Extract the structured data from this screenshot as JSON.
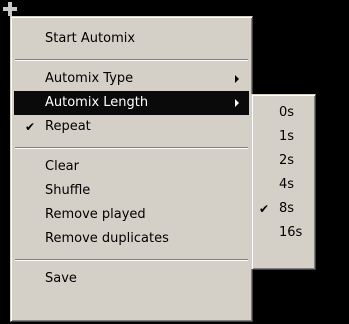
{
  "main_menu": {
    "items": [
      {
        "label": "Start Automix"
      },
      {
        "label": "Automix Type"
      },
      {
        "label": "Automix Length"
      },
      {
        "label": "Repeat",
        "checked": true
      },
      {
        "label": "Clear"
      },
      {
        "label": "Shuffle"
      },
      {
        "label": "Remove played"
      },
      {
        "label": "Remove duplicates"
      },
      {
        "label": "Save"
      }
    ]
  },
  "length_submenu": {
    "items": [
      {
        "label": "0s"
      },
      {
        "label": "1s"
      },
      {
        "label": "2s"
      },
      {
        "label": "4s"
      },
      {
        "label": "8s",
        "checked": true
      },
      {
        "label": "16s"
      }
    ]
  },
  "icons": {
    "check": "✔"
  },
  "colors": {
    "menu_bg": "#d4d0c8",
    "highlight_bg": "#0a0a0a",
    "highlight_text": "#ffffff",
    "desktop_bg": "#000000"
  }
}
